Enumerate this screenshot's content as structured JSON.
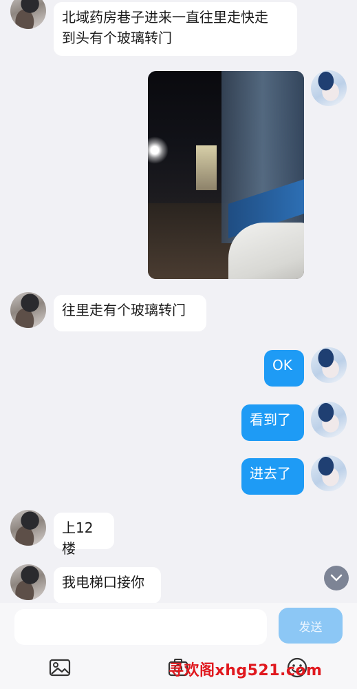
{
  "messages": [
    {
      "side": "in",
      "text_lines": [
        "北域药房巷子进来一直往里走快走",
        "到头有个玻璃转门"
      ]
    },
    {
      "side": "out",
      "type": "image"
    },
    {
      "side": "in",
      "text": "往里走有个玻璃转门"
    },
    {
      "side": "out",
      "text": "OK"
    },
    {
      "side": "out",
      "text": "看到了"
    },
    {
      "side": "out",
      "text": "进去了"
    },
    {
      "side": "in",
      "text": "上12楼"
    },
    {
      "side": "in",
      "text": "我电梯口接你"
    }
  ],
  "input": {
    "value": "",
    "placeholder": ""
  },
  "send_label": "发送",
  "watermark": "寻欢阁xhg521.com",
  "colors": {
    "outgoing_bubble": "#1e9bf5",
    "send_button": "#8cc7f5",
    "background": "#f1f1f5"
  }
}
